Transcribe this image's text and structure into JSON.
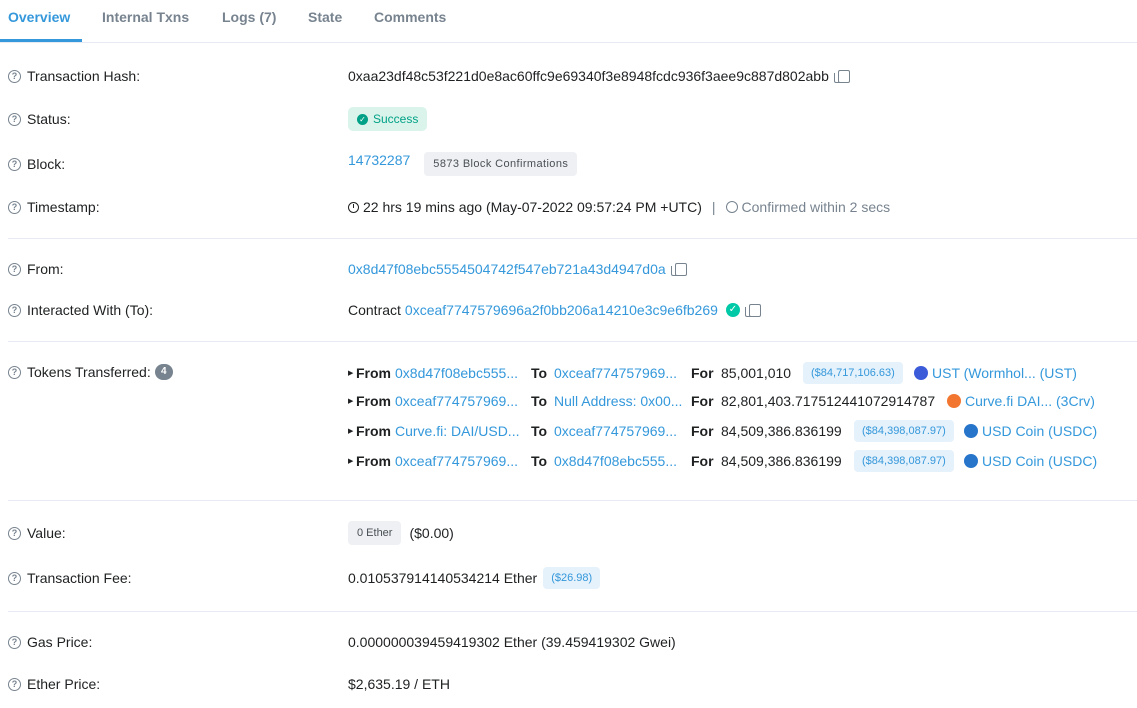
{
  "tabs": [
    {
      "label": "Overview",
      "active": true
    },
    {
      "label": "Internal Txns"
    },
    {
      "label": "Logs (7)"
    },
    {
      "label": "State"
    },
    {
      "label": "Comments"
    }
  ],
  "fields": {
    "tx_hash": {
      "label": "Transaction Hash:",
      "value": "0xaa23df48c53f221d0e8ac60ffc9e69340f3e8948fcdc936f3aee9c887d802abb"
    },
    "status": {
      "label": "Status:",
      "value": "Success"
    },
    "block": {
      "label": "Block:",
      "value": "14732287",
      "confirmations": "5873 Block Confirmations"
    },
    "timestamp": {
      "label": "Timestamp:",
      "value": "22 hrs 19 mins ago (May-07-2022 09:57:24 PM +UTC)",
      "separator": "|",
      "confirmed": "Confirmed within 2 secs"
    },
    "from": {
      "label": "From:",
      "value": "0x8d47f08ebc5554504742f547eb721a43d4947d0a"
    },
    "to": {
      "label": "Interacted With (To):",
      "prefix": "Contract",
      "value": "0xceaf7747579696a2f0bb206a14210e3c9e6fb269"
    },
    "tokens": {
      "label": "Tokens Transferred:",
      "count": "4"
    },
    "value": {
      "label": "Value:",
      "badge": "0 Ether",
      "usd": "($0.00)"
    },
    "fee": {
      "label": "Transaction Fee:",
      "value": "0.010537914140534214 Ether",
      "usd": "($26.98)"
    },
    "gas": {
      "label": "Gas Price:",
      "value": "0.000000039459419302 Ether (39.459419302 Gwei)"
    },
    "ether_price": {
      "label": "Ether Price:",
      "value": "$2,635.19 / ETH"
    }
  },
  "transfers": [
    {
      "from_word": "From",
      "from": "0x8d47f08ebc555...",
      "to_word": "To",
      "to": "0xceaf774757969...",
      "for_word": "For",
      "amount": "85,001,010",
      "usd": "($84,717,106.63)",
      "token": "UST (Wormhol... (UST)",
      "icon": "ust-token-icon",
      "icon_color": "#3b5bd9"
    },
    {
      "from_word": "From",
      "from": "0xceaf774757969...",
      "to_word": "To",
      "to": "Null Address: 0x00...",
      "for_word": "For",
      "amount": "82,801,403.717512441072914787",
      "usd": "",
      "token": "Curve.fi DAI... (3Crv)",
      "icon": "curve-token-icon",
      "icon_color": "#f2762f"
    },
    {
      "from_word": "From",
      "from": "Curve.fi: DAI/USD...",
      "to_word": "To",
      "to": "0xceaf774757969...",
      "for_word": "For",
      "amount": "84,509,386.836199",
      "usd": "($84,398,087.97)",
      "token": "USD Coin (USDC)",
      "icon": "usdc-token-icon",
      "icon_color": "#2775ca"
    },
    {
      "from_word": "From",
      "from": "0xceaf774757969...",
      "to_word": "To",
      "to": "0x8d47f08ebc555...",
      "for_word": "For",
      "amount": "84,509,386.836199",
      "usd": "($84,398,087.97)",
      "token": "USD Coin (USDC)",
      "icon": "usdc-token-icon",
      "icon_color": "#2775ca"
    }
  ]
}
